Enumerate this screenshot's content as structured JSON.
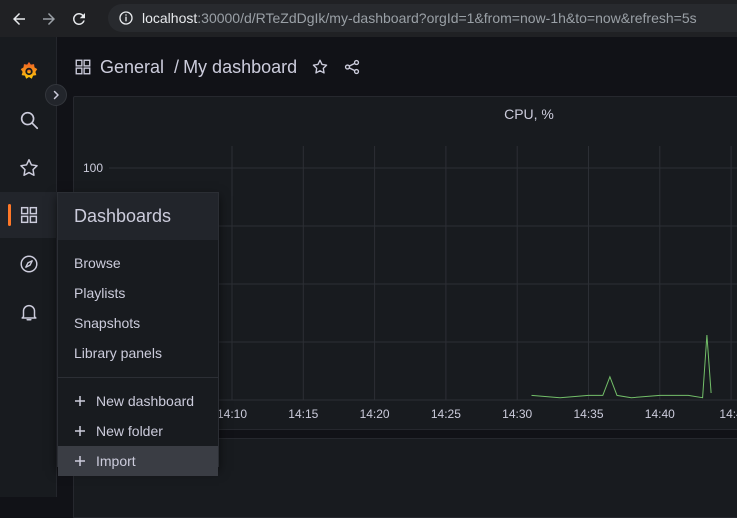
{
  "browser": {
    "url_host": "localhost",
    "url_rest": ":30000/d/RTeZdDgIk/my-dashboard?orgId=1&from=now-1h&to=now&refresh=5s"
  },
  "breadcrumb": {
    "folder": "General",
    "separator": "/",
    "dashboard": "My dashboard"
  },
  "panel": {
    "title": "CPU, %"
  },
  "chart_data": {
    "type": "line",
    "title": "CPU, %",
    "x_tick_labels": [
      "14:10",
      "14:15",
      "14:20",
      "14:25",
      "14:30",
      "14:35",
      "14:40",
      "14:4"
    ],
    "y_tick_labels": [
      "100"
    ],
    "series": [
      {
        "color": "#73bf69",
        "x": [
          "14:31",
          "14:33",
          "14:35",
          "14:36",
          "14:36.5",
          "14:37",
          "14:38",
          "14:40",
          "14:42",
          "14:43",
          "14:43.3",
          "14:43.6"
        ],
        "values": [
          2,
          1,
          2,
          2,
          10,
          2,
          1,
          2,
          2,
          1,
          28,
          3
        ]
      }
    ]
  },
  "dropdown": {
    "header": "Dashboards",
    "items": [
      "Browse",
      "Playlists",
      "Snapshots",
      "Library panels"
    ],
    "actions": [
      "New dashboard",
      "New folder",
      "Import"
    ]
  },
  "colors": {
    "accent": "#ff7828",
    "series": "#73bf69"
  }
}
